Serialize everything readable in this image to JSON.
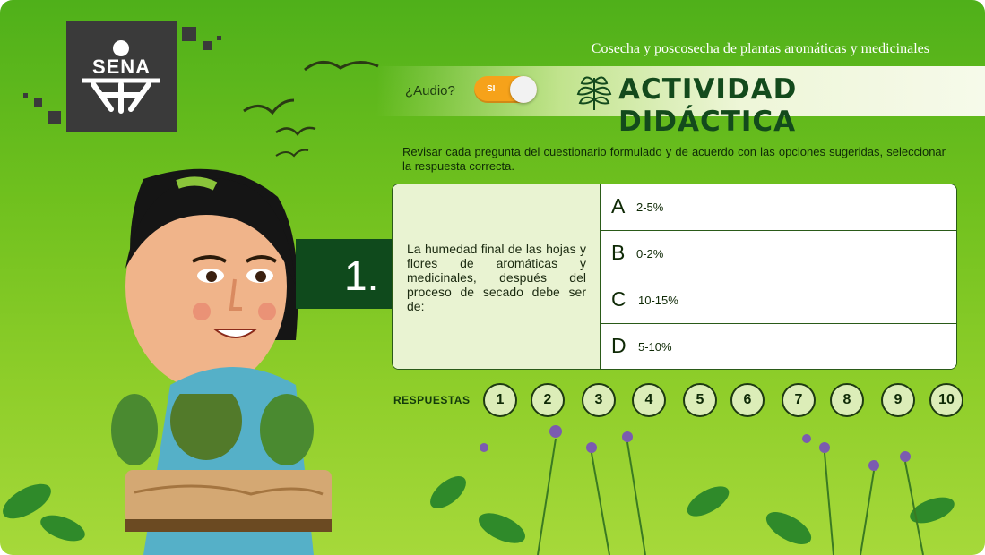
{
  "header": {
    "logo_text": "SENA",
    "course_title": "Cosecha y poscosecha de plantas aromáticas y medicinales",
    "activity_title": "ACTIVIDAD DIDÁCTICA",
    "audio_label": "¿Audio?",
    "audio_toggle_state": "SI",
    "icon": "leaf-tree-icon"
  },
  "instructions": "Revisar cada pregunta del cuestionario formulado y de acuerdo con las opciones sugeridas, seleccionar la respuesta correcta.",
  "question": {
    "number": "1.",
    "text": "La humedad final de las hojas y flores de aromáticas y medicinales, después del proceso de secado debe ser de:",
    "options": [
      {
        "letter": "A",
        "value": "2-5%"
      },
      {
        "letter": "B",
        "value": "0-2%"
      },
      {
        "letter": "C",
        "value": "10-15%"
      },
      {
        "letter": "D",
        "value": "5-10%"
      }
    ]
  },
  "answers": {
    "label": "RESPUESTAS",
    "numbers": [
      "1",
      "2",
      "3",
      "4",
      "5",
      "6",
      "7",
      "8",
      "9",
      "10"
    ]
  },
  "colors": {
    "background": "#6fc01e",
    "dark_green": "#0f4a1c",
    "toggle": "#f6a21a",
    "logo_bg": "#3a3a3a"
  }
}
